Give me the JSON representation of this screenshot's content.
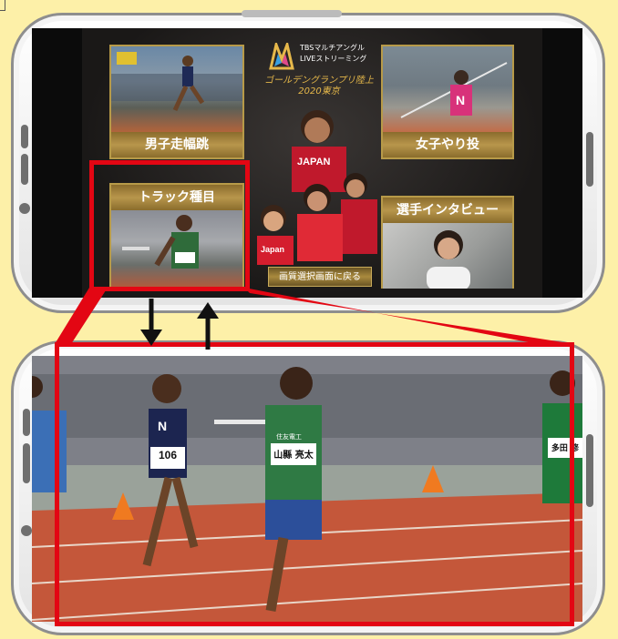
{
  "menu": {
    "logo": {
      "line1": "TBSマルチアングル",
      "line2": "LIVEストリーミング"
    },
    "event_title": {
      "line1": "ゴールデングランプリ陸上",
      "line2": "2020東京"
    },
    "tiles": {
      "mens_long_jump": "男子走幅跳",
      "womens_javelin": "女子やり投",
      "track_events": "トラック種目",
      "athlete_interview": "選手インタビュー"
    },
    "back_button": "画質選択画面に戻る"
  },
  "race": {
    "bibs": {
      "left_runner": "106",
      "center_runner": "山縣 亮太",
      "right_runner": "多田 修"
    },
    "sponsor_text": "住友電工"
  },
  "colors": {
    "highlight": "#e30613",
    "background": "#fdf0a8",
    "gold": "#b79a48"
  }
}
